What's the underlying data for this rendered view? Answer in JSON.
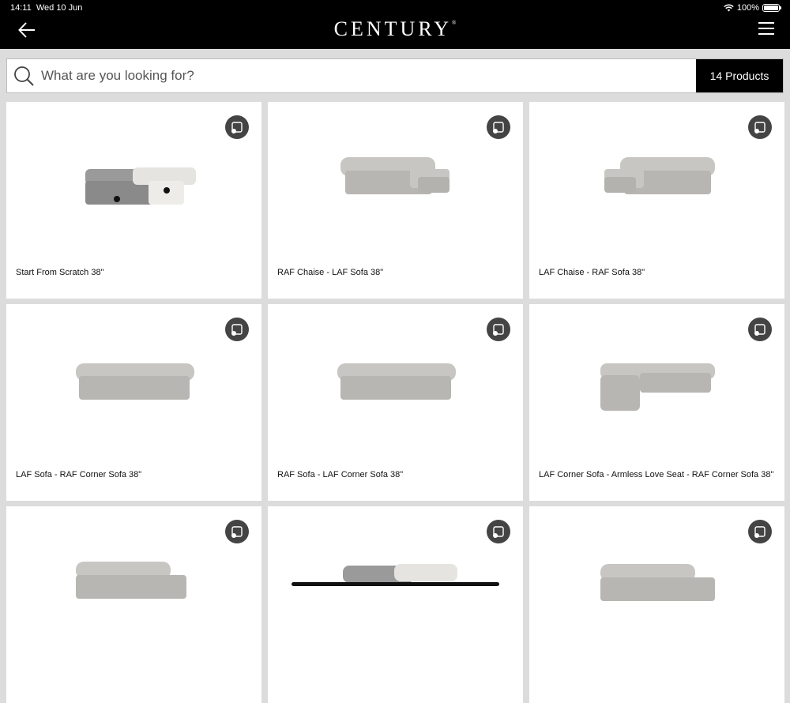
{
  "status": {
    "time": "14:11",
    "date": "Wed 10 Jun",
    "battery": "100%"
  },
  "header": {
    "brand": "CENTURY",
    "brand_mark": "®"
  },
  "search": {
    "placeholder": "What are you looking for?",
    "count_label": "14 Products"
  },
  "products": [
    {
      "name": "Start From Scratch 38\""
    },
    {
      "name": "RAF Chaise - LAF Sofa 38\""
    },
    {
      "name": "LAF Chaise - RAF Sofa 38\""
    },
    {
      "name": "LAF Sofa - RAF Corner Sofa 38\""
    },
    {
      "name": "RAF Sofa - LAF Corner Sofa 38\""
    },
    {
      "name": "LAF Corner Sofa - Armless Love Seat - RAF Corner Sofa 38\""
    },
    {
      "name": ""
    },
    {
      "name": ""
    },
    {
      "name": ""
    }
  ],
  "icons": {
    "back": "arrow-left-icon",
    "menu": "hamburger-icon",
    "search": "search-icon",
    "ar": "ar-view-icon"
  },
  "colors": {
    "topbar": "#000000",
    "background": "#dcdcdc",
    "accent": "#000000"
  }
}
